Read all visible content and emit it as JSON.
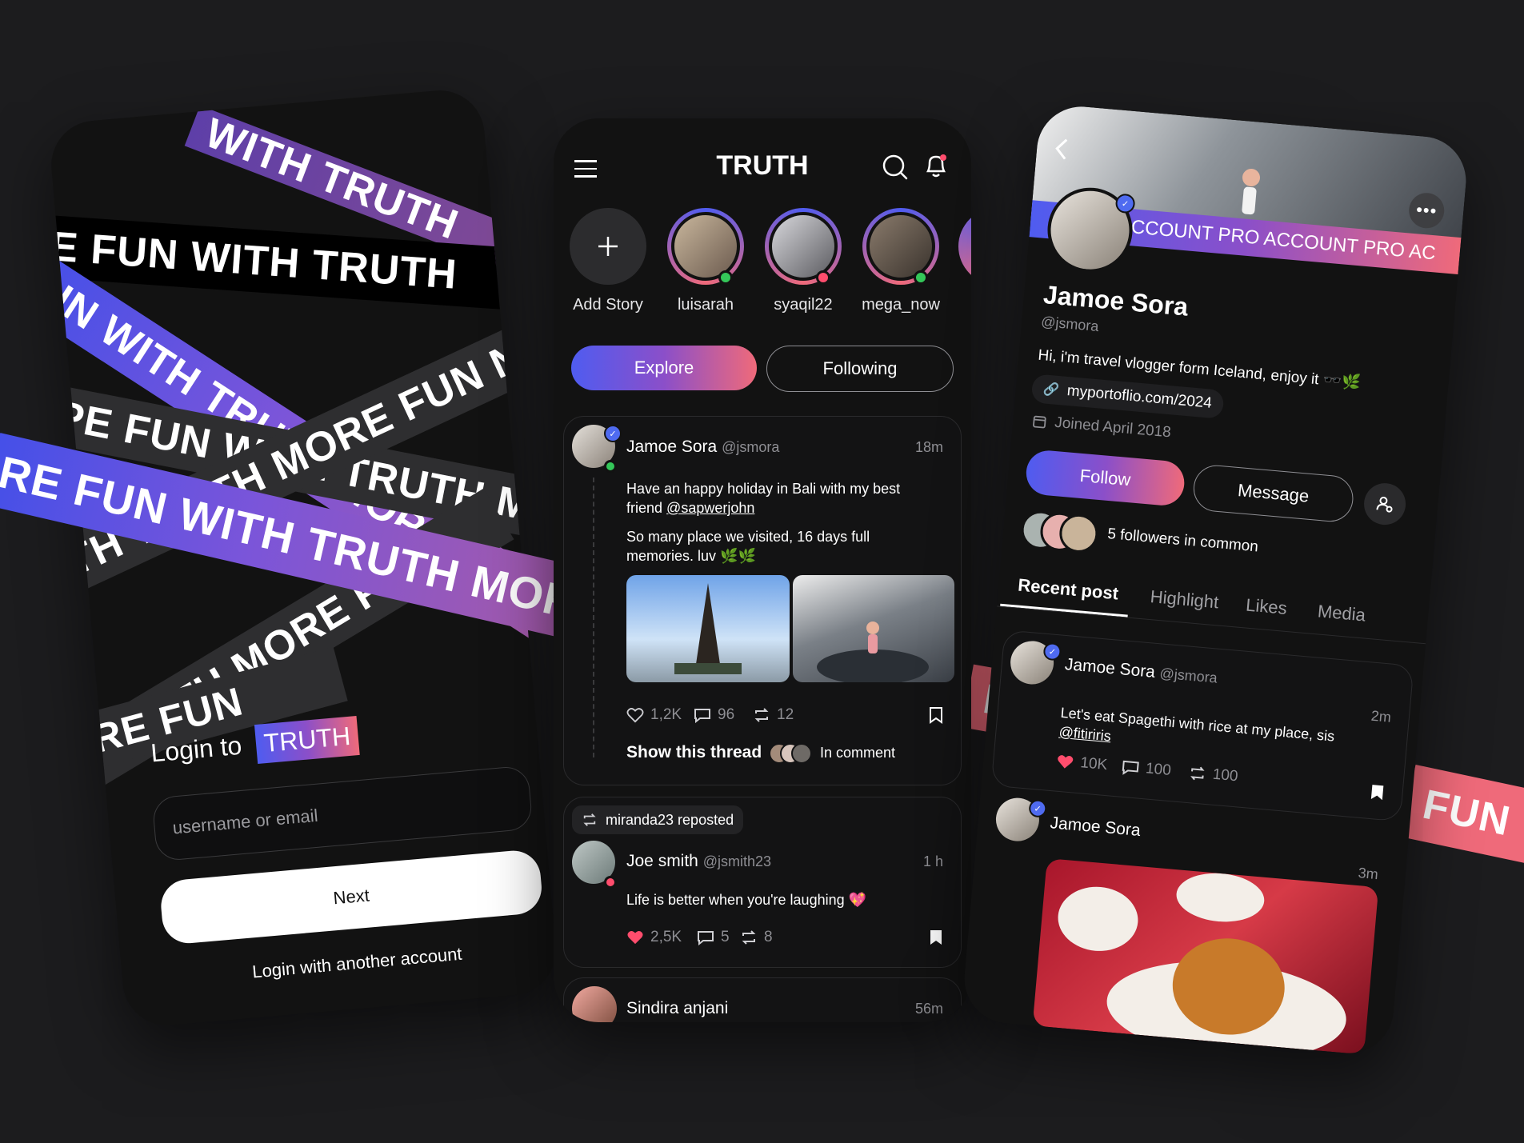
{
  "colors": {
    "accent_start": "#4f5cf0",
    "accent_end": "#ef6a7a",
    "background": "#1c1c1e",
    "screen": "#121212",
    "like": "#ff4d6d"
  },
  "ribbons": {
    "text_1": "WITH TRUTH",
    "text_2": "E FUN WITH TRUTH",
    "text_3": "UN WITH TRUTH MORE FUN",
    "text_4": "PE FUN WITH TRUTH MORE FUN W",
    "text_5": "TH TRUTH MORE FUN NOW",
    "text_6": "RE FUN WITH TRUTH MORE FUN",
    "text_7": "TRUTH MORE FU",
    "text_8": "RE FUN",
    "side_1": "FUN W",
    "side_2": "FU"
  },
  "login": {
    "prefix": "Login to",
    "brand": "TRUTH",
    "username_placeholder": "username or email",
    "next_label": "Next",
    "alt_login_label": "Login with another account"
  },
  "feed": {
    "app_title": "TRUTH",
    "stories": [
      {
        "name": "Add Story"
      },
      {
        "name": "luisarah"
      },
      {
        "name": "syaqil22"
      },
      {
        "name": "mega_now"
      }
    ],
    "tabs": {
      "explore": "Explore",
      "following": "Following"
    },
    "post1": {
      "name": "Jamoe Sora",
      "handle": "@jsmora",
      "time": "18m",
      "text1": "Have an happy holiday in Bali with my best friend",
      "mention": "@sapwerjohn",
      "text2": "So many place we visited, 16 days full memories. luv 🌿🌿",
      "likes": "1,2K",
      "comments": "96",
      "reposts": "12",
      "thread_label": "Show this thread",
      "comment_label": "In comment"
    },
    "repost_label": "miranda23 reposted",
    "post2": {
      "name": "Joe smith",
      "handle": "@jsmith23",
      "time": "1 h",
      "text": "Life is better when you're laughing 💖",
      "likes": "2,5K",
      "comments": "5",
      "reposts": "8"
    },
    "post3": {
      "name": "Sindira anjani",
      "time": "56m"
    }
  },
  "profile": {
    "banner_text": "ACCOUNT PRO ACCOUNT PRO AC",
    "name": "Jamoe Sora",
    "handle": "@jsmora",
    "bio": "Hi, i'm travel vlogger form Iceland, enjoy it 🕶️🌿",
    "link": "myportoflio.com/2024",
    "joined": "Joined April 2018",
    "follow_label": "Follow",
    "message_label": "Message",
    "common_followers": "5 followers in common",
    "tabs": [
      "Recent post",
      "Highlight",
      "Likes",
      "Media"
    ],
    "post1": {
      "name": "Jamoe Sora",
      "handle": "@jsmora",
      "time": "2m",
      "text": "Let's eat Spagethi with rice at my place, sis",
      "mention": "@fitiriris",
      "likes": "10K",
      "comments": "100",
      "reposts": "100"
    },
    "post2": {
      "name": "Jamoe Sora",
      "time": "3m"
    }
  }
}
